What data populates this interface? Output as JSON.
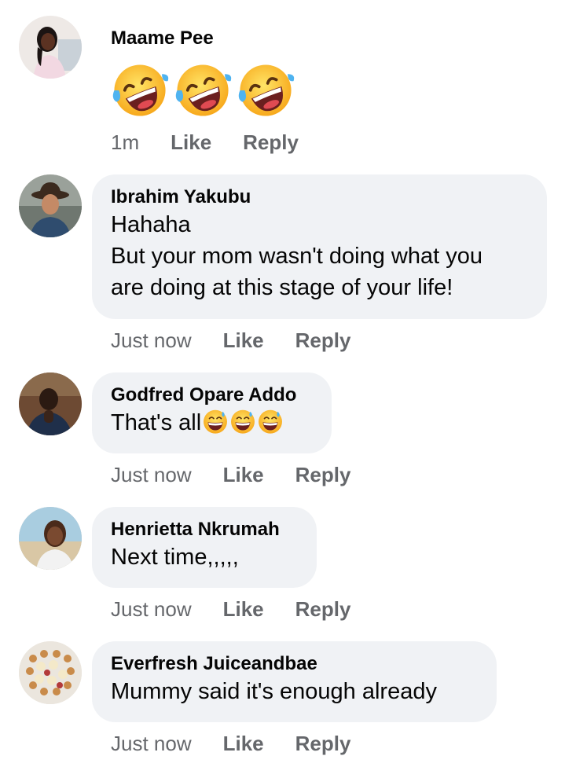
{
  "comments": [
    {
      "name": "Maame Pee",
      "text": "",
      "emoji": [
        "rofl-emoji",
        "rofl-emoji",
        "rofl-emoji"
      ],
      "time": "1m",
      "like": "Like",
      "reply": "Reply"
    },
    {
      "name": "Ibrahim Yakubu",
      "text": "Hahaha",
      "text2": "But your mom wasn't doing what you",
      "text3": "are doing at this stage of your life!",
      "time": "Just now",
      "like": "Like",
      "reply": "Reply"
    },
    {
      "name": "Godfred Opare Addo",
      "text": "That's all",
      "emoji": [
        "grinning-sweat-emoji",
        "grinning-sweat-emoji",
        "grinning-sweat-emoji"
      ],
      "time": "Just now",
      "like": "Like",
      "reply": "Reply"
    },
    {
      "name": "Henrietta Nkrumah",
      "text": "Next time,,,,,",
      "time": "Just now",
      "like": "Like",
      "reply": "Reply"
    },
    {
      "name": "Everfresh Juiceandbae",
      "text": "Mummy said it's enough already",
      "time": "Just now",
      "like": "Like",
      "reply": "Reply"
    }
  ],
  "colors": {
    "bubble": "#f0f2f5",
    "meta_text": "#65676b",
    "name_text": "#050505"
  }
}
